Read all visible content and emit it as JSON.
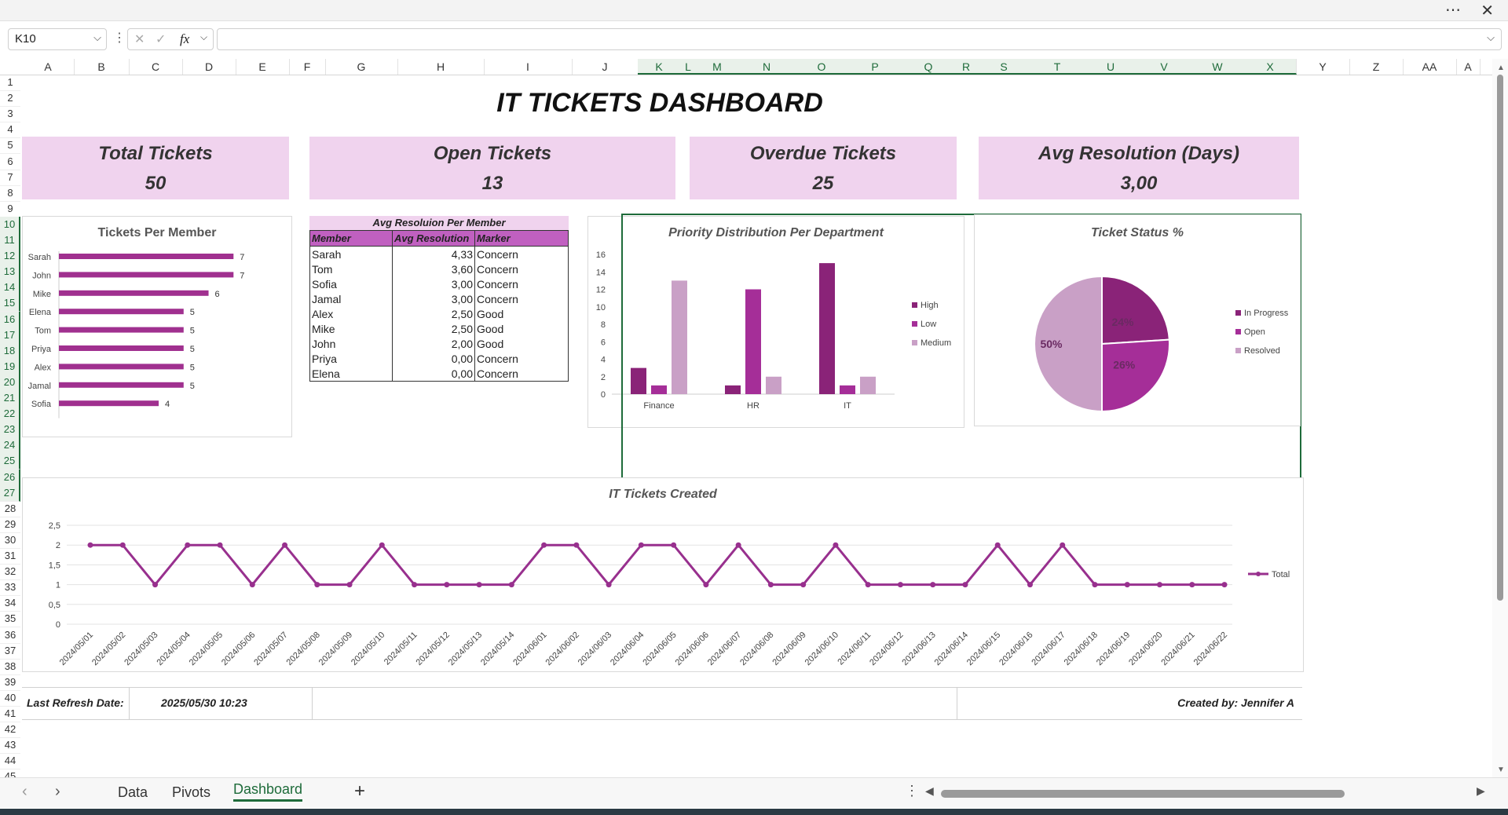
{
  "formula_bar": {
    "name_box": "K10",
    "formula": "",
    "fx": "fx"
  },
  "columns": [
    "A",
    "B",
    "C",
    "D",
    "E",
    "F",
    "G",
    "H",
    "I",
    "J",
    "K",
    "L",
    "M",
    "N",
    "O",
    "P",
    "Q",
    "R",
    "S",
    "T",
    "U",
    "V",
    "W",
    "X",
    "Y",
    "Z",
    "AA",
    "A"
  ],
  "rows": [
    "1",
    "2",
    "3",
    "4",
    "5",
    "6",
    "7",
    "8",
    "9",
    "10",
    "11",
    "12",
    "13",
    "14",
    "15",
    "16",
    "17",
    "18",
    "19",
    "20",
    "21",
    "22",
    "23",
    "24",
    "25",
    "26",
    "27",
    "28",
    "29",
    "30",
    "31",
    "32",
    "33",
    "34",
    "35",
    "36",
    "37",
    "38",
    "39",
    "40",
    "41",
    "42",
    "43",
    "44",
    "45"
  ],
  "dashboard": {
    "title": "IT TICKETS DASHBOARD",
    "kpis": [
      {
        "label": "Total Tickets",
        "value": "50"
      },
      {
        "label": "Open Tickets",
        "value": "13"
      },
      {
        "label": "Overdue Tickets",
        "value": "25"
      },
      {
        "label": "Avg Resolution (Days)",
        "value": "3,00"
      }
    ],
    "avg_table": {
      "title": "Avg Resoluion Per Member",
      "headers": [
        "Member",
        "Avg Resolution",
        "Marker"
      ],
      "rows": [
        [
          "Sarah",
          "4,33",
          "Concern"
        ],
        [
          "Tom",
          "3,60",
          "Concern"
        ],
        [
          "Sofia",
          "3,00",
          "Concern"
        ],
        [
          "Jamal",
          "3,00",
          "Concern"
        ],
        [
          "Alex",
          "2,50",
          "Good"
        ],
        [
          "Mike",
          "2,50",
          "Good"
        ],
        [
          "John",
          "2,00",
          "Good"
        ],
        [
          "Priya",
          "0,00",
          "Concern"
        ],
        [
          "Elena",
          "0,00",
          "Concern"
        ]
      ]
    },
    "footer": {
      "refresh_label": "Last Refresh Date:",
      "refresh_value": "2025/05/30 10:23",
      "created_by": "Created by: Jennifer A"
    }
  },
  "chart_data": [
    {
      "type": "bar",
      "orientation": "horizontal",
      "title": "Tickets Per Member",
      "categories": [
        "Sarah",
        "John",
        "Mike",
        "Elena",
        "Tom",
        "Priya",
        "Alex",
        "Jamal",
        "Sofia"
      ],
      "values": [
        7,
        7,
        6,
        5,
        5,
        5,
        5,
        5,
        4
      ],
      "color": "#a0308f"
    },
    {
      "type": "bar",
      "title": "Priority Distribution Per Department",
      "categories": [
        "Finance",
        "HR",
        "IT"
      ],
      "series": [
        {
          "name": "High",
          "values": [
            3,
            1,
            15
          ],
          "color": "#8a2378"
        },
        {
          "name": "Low",
          "values": [
            1,
            12,
            1
          ],
          "color": "#a52e98"
        },
        {
          "name": "Medium",
          "values": [
            13,
            2,
            2
          ],
          "color": "#c9a0c6"
        }
      ],
      "ylim": [
        0,
        16
      ],
      "yticks": [
        0,
        2,
        4,
        6,
        8,
        10,
        12,
        14,
        16
      ],
      "legend": "right"
    },
    {
      "type": "pie",
      "title": "Ticket Status %",
      "labels": [
        "In Progress",
        "Open",
        "Resolved"
      ],
      "values": [
        24,
        26,
        50
      ],
      "label_text": [
        "24%",
        "26%",
        "50%"
      ],
      "colors": [
        "#8a2378",
        "#a52e98",
        "#c9a0c6"
      ],
      "legend": "right"
    },
    {
      "type": "line",
      "title": "IT Tickets Created",
      "x": [
        "2024/05/01",
        "2024/05/02",
        "2024/05/03",
        "2024/05/04",
        "2024/05/05",
        "2024/05/06",
        "2024/05/07",
        "2024/05/08",
        "2024/05/09",
        "2024/05/10",
        "2024/05/11",
        "2024/05/12",
        "2024/05/13",
        "2024/05/14",
        "2024/06/01",
        "2024/06/02",
        "2024/06/03",
        "2024/06/04",
        "2024/06/05",
        "2024/06/06",
        "2024/06/07",
        "2024/06/08",
        "2024/06/09",
        "2024/06/10",
        "2024/06/11",
        "2024/06/12",
        "2024/06/13",
        "2024/06/14",
        "2024/06/15",
        "2024/06/16",
        "2024/06/17",
        "2024/06/18",
        "2024/06/19",
        "2024/06/20",
        "2024/06/21",
        "2024/06/22"
      ],
      "series": [
        {
          "name": "Total",
          "values": [
            2,
            2,
            1,
            2,
            2,
            1,
            2,
            1,
            1,
            2,
            1,
            1,
            1,
            1,
            2,
            2,
            1,
            2,
            2,
            1,
            2,
            1,
            1,
            2,
            1,
            1,
            1,
            1,
            2,
            1,
            2,
            1,
            1,
            1,
            1,
            1
          ],
          "color": "#98308e"
        }
      ],
      "ylim": [
        0,
        2.5
      ],
      "yticks": [
        "0",
        "0,5",
        "1",
        "1,5",
        "2",
        "2,5"
      ],
      "legend": "right"
    }
  ],
  "sheet_tabs": {
    "tabs": [
      "Data",
      "Pivots",
      "Dashboard"
    ],
    "active": "Dashboard",
    "add": "+"
  }
}
